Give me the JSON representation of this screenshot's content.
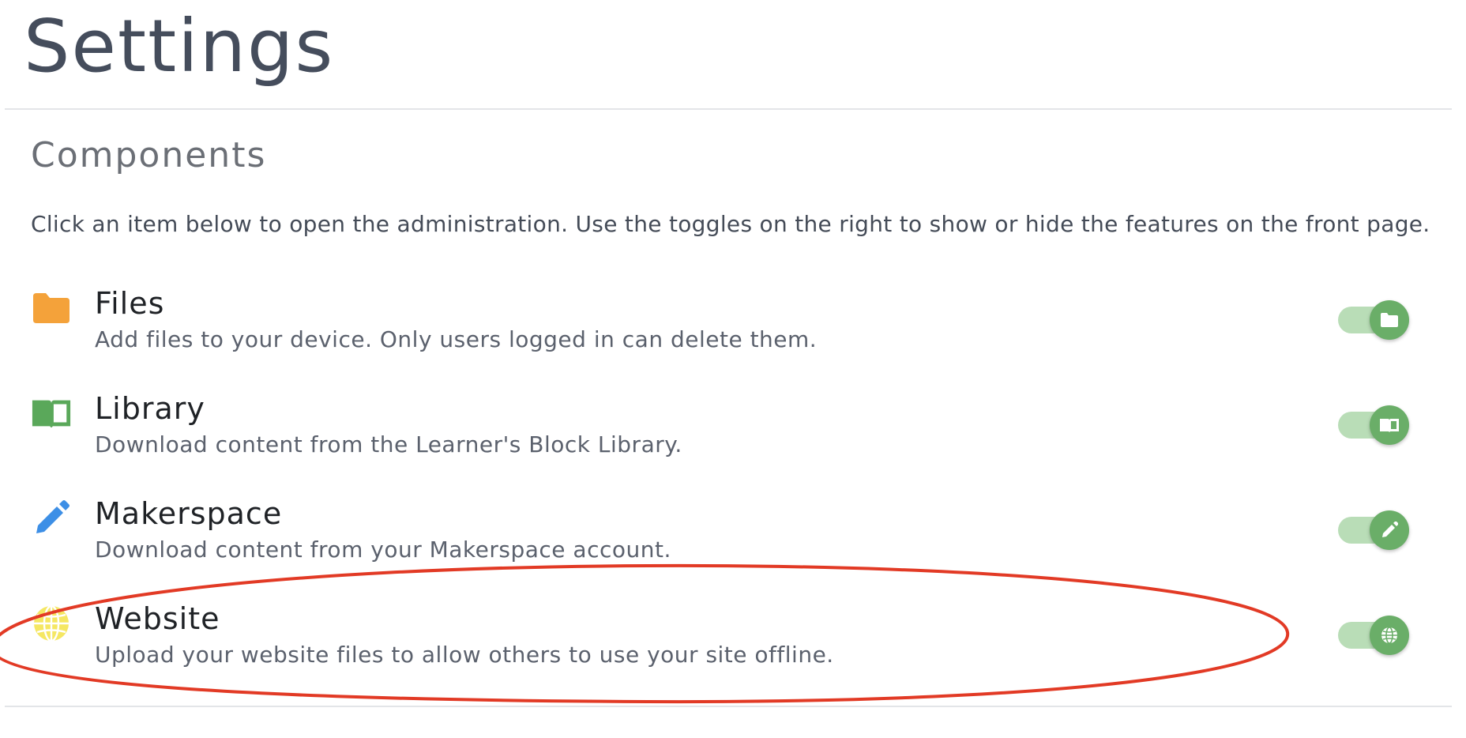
{
  "page": {
    "title": "Settings"
  },
  "section": {
    "title": "Components",
    "intro": "Click an item below to open the administration. Use the toggles on the right to show or hide the features on the front page."
  },
  "components": [
    {
      "name": "Files",
      "description": "Add files to your device. Only users logged in can delete them.",
      "icon": "folder-icon",
      "icon_color": "#f4a23a",
      "enabled": true
    },
    {
      "name": "Library",
      "description": "Download content from the Learner's Block Library.",
      "icon": "book-icon",
      "icon_color": "#5aa85a",
      "enabled": true
    },
    {
      "name": "Makerspace",
      "description": "Download content from your Makerspace account.",
      "icon": "pencil-icon",
      "icon_color": "#3d8fe6",
      "enabled": true
    },
    {
      "name": "Website",
      "description": "Upload your website files to allow others to use your site offline.",
      "icon": "globe-icon",
      "icon_color": "#f5e763",
      "enabled": true
    }
  ],
  "colors": {
    "toggle_track": "#b9ddb7",
    "toggle_knob": "#6aae68",
    "annotation": "#e23a25"
  }
}
